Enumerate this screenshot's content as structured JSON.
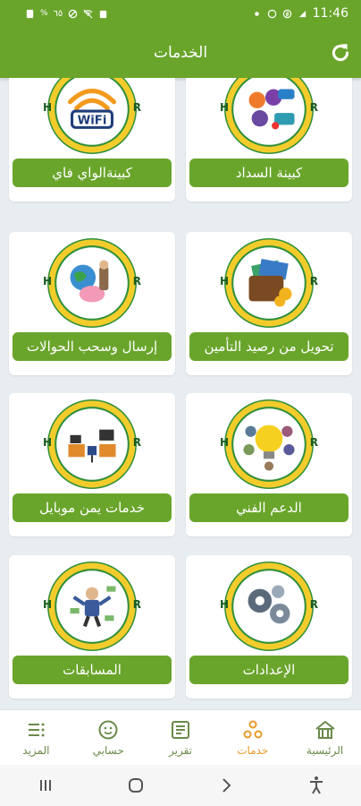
{
  "status_bar": {
    "time": "11:46",
    "left_text": "%",
    "left_text2": "٦٥"
  },
  "header": {
    "title": "الخدمات"
  },
  "cards": [
    {
      "label": "كبينة السداد",
      "logo": "payment-brands-logo"
    },
    {
      "label": "كبينةالواي فاي",
      "logo": "wifi-logo"
    },
    {
      "label": "تحويل من رصيد التأمين",
      "logo": "wallet-money-logo"
    },
    {
      "label": "إرسال وسحب الحوالات",
      "logo": "globe-piggybank-logo"
    },
    {
      "label": "الدعم الفني",
      "logo": "lightbulb-team-logo"
    },
    {
      "label": "خدمات يمن موبايل",
      "logo": "office-desks-logo"
    },
    {
      "label": "الإعدادات",
      "logo": "gears-logo"
    },
    {
      "label": "المسابقات",
      "logo": "money-man-logo"
    }
  ],
  "logo_badge": {
    "left": "H",
    "right": "R"
  },
  "bottom_nav": [
    {
      "label": "الرئيسية",
      "icon": "home-icon",
      "active": false
    },
    {
      "label": "خدمات",
      "icon": "services-icon",
      "active": true
    },
    {
      "label": "تقرير",
      "icon": "report-icon",
      "active": false
    },
    {
      "label": "حسابي",
      "icon": "smile-icon",
      "active": false
    },
    {
      "label": "المزيد",
      "icon": "more-icon",
      "active": false
    }
  ],
  "colors": {
    "primary": "#6aa52b",
    "active": "#e99a2a",
    "background": "#e8edf1"
  }
}
